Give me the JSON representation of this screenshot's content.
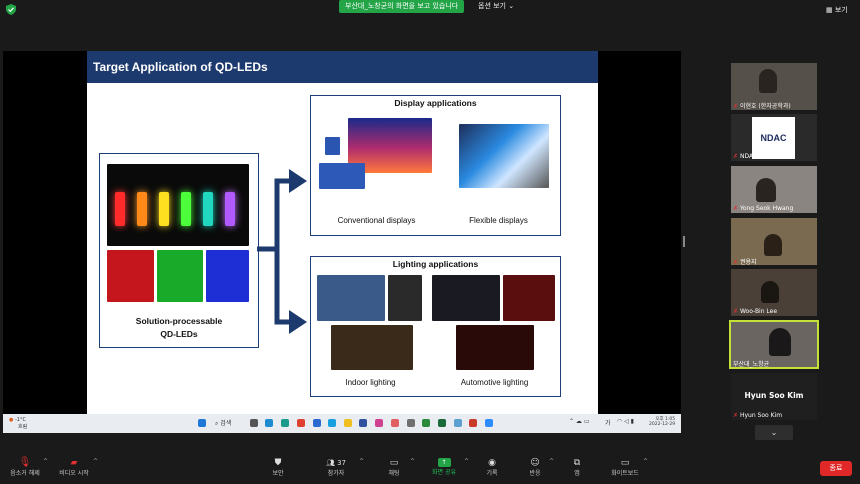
{
  "topbar": {
    "share_banner": "부산대_노창균의 화면을 보고 있습니다",
    "view_options": "옵션 보기",
    "view_button": "보기"
  },
  "slide": {
    "title": "Target Application of QD-LEDs",
    "left_box_label_1": "Solution-processable",
    "left_box_label_2": "QD-LEDs",
    "display_title": "Display applications",
    "conventional_caption": "Conventional displays",
    "flexible_caption": "Flexible displays",
    "lighting_title": "Lighting applications",
    "indoor_caption": "Indoor lighting",
    "automotive_caption": "Automotive lighting"
  },
  "taskbar": {
    "search_label": "검색",
    "weather_temp": "-1°C",
    "weather_desc": "흐림",
    "ime": "가",
    "time": "오후 1:05",
    "date": "2022-12-29"
  },
  "participants": [
    {
      "name": "이현호 (한자공학과)"
    },
    {
      "name": "NDAC",
      "logo": "NDAC"
    },
    {
      "name": "Yong Seok Hwang"
    },
    {
      "name": "권용지"
    },
    {
      "name": "Woo-Bin Lee"
    },
    {
      "name": "부산대_노창균"
    },
    {
      "name": "Hyun Soo Kim",
      "display": "Hyun Soo Kim"
    }
  ],
  "toolbar": {
    "mute": "음소거 해제",
    "video": "비디오 시작",
    "security": "보안",
    "participants": "참가자",
    "participant_count": "37",
    "chat": "채팅",
    "share": "화면 공유",
    "record": "기록",
    "reactions": "반응",
    "apps": "앱",
    "whiteboard": "화이트보드",
    "end": "종료"
  },
  "colors": {
    "slide_header": "#1d3a6e",
    "box_border": "#1f3f78",
    "share_green": "#22a447",
    "end_red": "#e02828",
    "active_speaker": "#c6e03a"
  }
}
